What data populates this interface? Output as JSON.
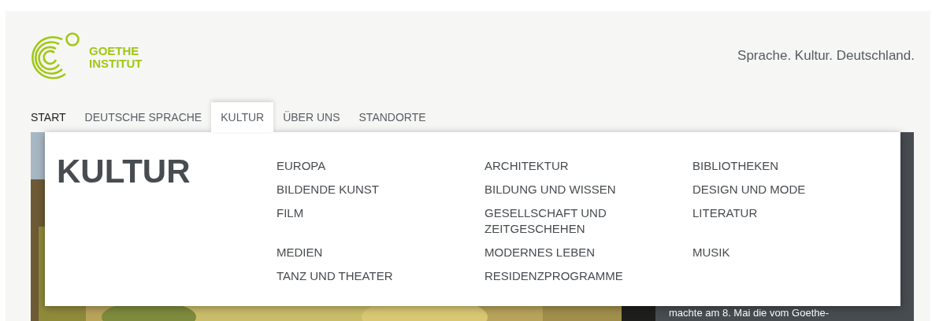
{
  "logo": {
    "lines": [
      "GOETHE",
      "INSTITUT"
    ]
  },
  "tagline": "Sprache. Kultur. Deutschland.",
  "nav": [
    {
      "label": "START",
      "selected": false,
      "current": true
    },
    {
      "label": "DEUTSCHE SPRACHE",
      "selected": false,
      "current": false
    },
    {
      "label": "KULTUR",
      "selected": true,
      "current": false
    },
    {
      "label": "ÜBER UNS",
      "selected": false,
      "current": false
    },
    {
      "label": "STANDORTE",
      "selected": false,
      "current": false
    }
  ],
  "menu": {
    "title": "KULTUR",
    "items": [
      "EUROPA",
      "ARCHITEKTUR",
      "BIBLIOTHEKEN",
      "BILDENDE KUNST",
      "BILDUNG UND WISSEN",
      "DESIGN UND MODE",
      "FILM",
      "GESELLSCHAFT UND ZEITGESCHEHEN",
      "LITERATUR",
      "MEDIEN",
      "MODERNES LEBEN",
      "MUSIK",
      "TANZ UND THEATER",
      "RESIDENZPROGRAMME"
    ]
  },
  "hero": {
    "caption": "machte am 8. Mai die vom Goethe-"
  }
}
